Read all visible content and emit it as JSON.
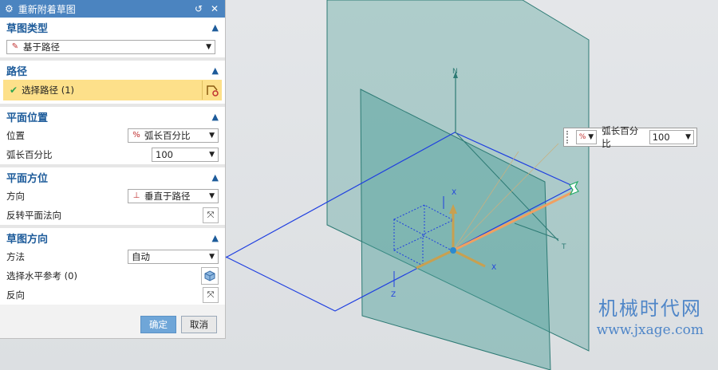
{
  "dialog": {
    "title": "重新附着草图",
    "icons": {
      "gear": "gear-icon",
      "reset": "reset-icon",
      "close": "close-icon"
    }
  },
  "sections": {
    "sketch_type": {
      "header": "草图类型",
      "select_value": "基于路径",
      "select_icon": "path-sketch-icon"
    },
    "path": {
      "header": "路径",
      "select_path_label": "选择路径 (1)"
    },
    "plane_position": {
      "header": "平面位置",
      "position_label": "位置",
      "position_value": "弧长百分比",
      "arc_percent_label": "弧长百分比",
      "arc_percent_value": "100"
    },
    "plane_orientation": {
      "header": "平面方位",
      "direction_label": "方向",
      "direction_value": "垂直于路径",
      "reverse_normal_label": "反转平面法向"
    },
    "sketch_orientation": {
      "header": "草图方向",
      "method_label": "方法",
      "method_value": "自动",
      "horizontal_ref_label": "选择水平参考 (0)",
      "reverse_label": "反向"
    }
  },
  "buttons": {
    "ok": "确定",
    "cancel": "取消"
  },
  "popup": {
    "label": "弧长百分比",
    "value": "100"
  },
  "viewport_labels": {
    "axis_n": "N",
    "axis_t": "T",
    "axis_x": "X",
    "axis_x2": "X",
    "axis_z": "Z"
  },
  "watermark": {
    "cn": "机械时代网",
    "en": "www.jxage.com"
  },
  "colors": {
    "accent": "#4b84c0",
    "highlight": "#fde08a",
    "plane": "#4a9e96",
    "sketch_lines": "#1f3fe0",
    "path_line": "#f0a060"
  }
}
